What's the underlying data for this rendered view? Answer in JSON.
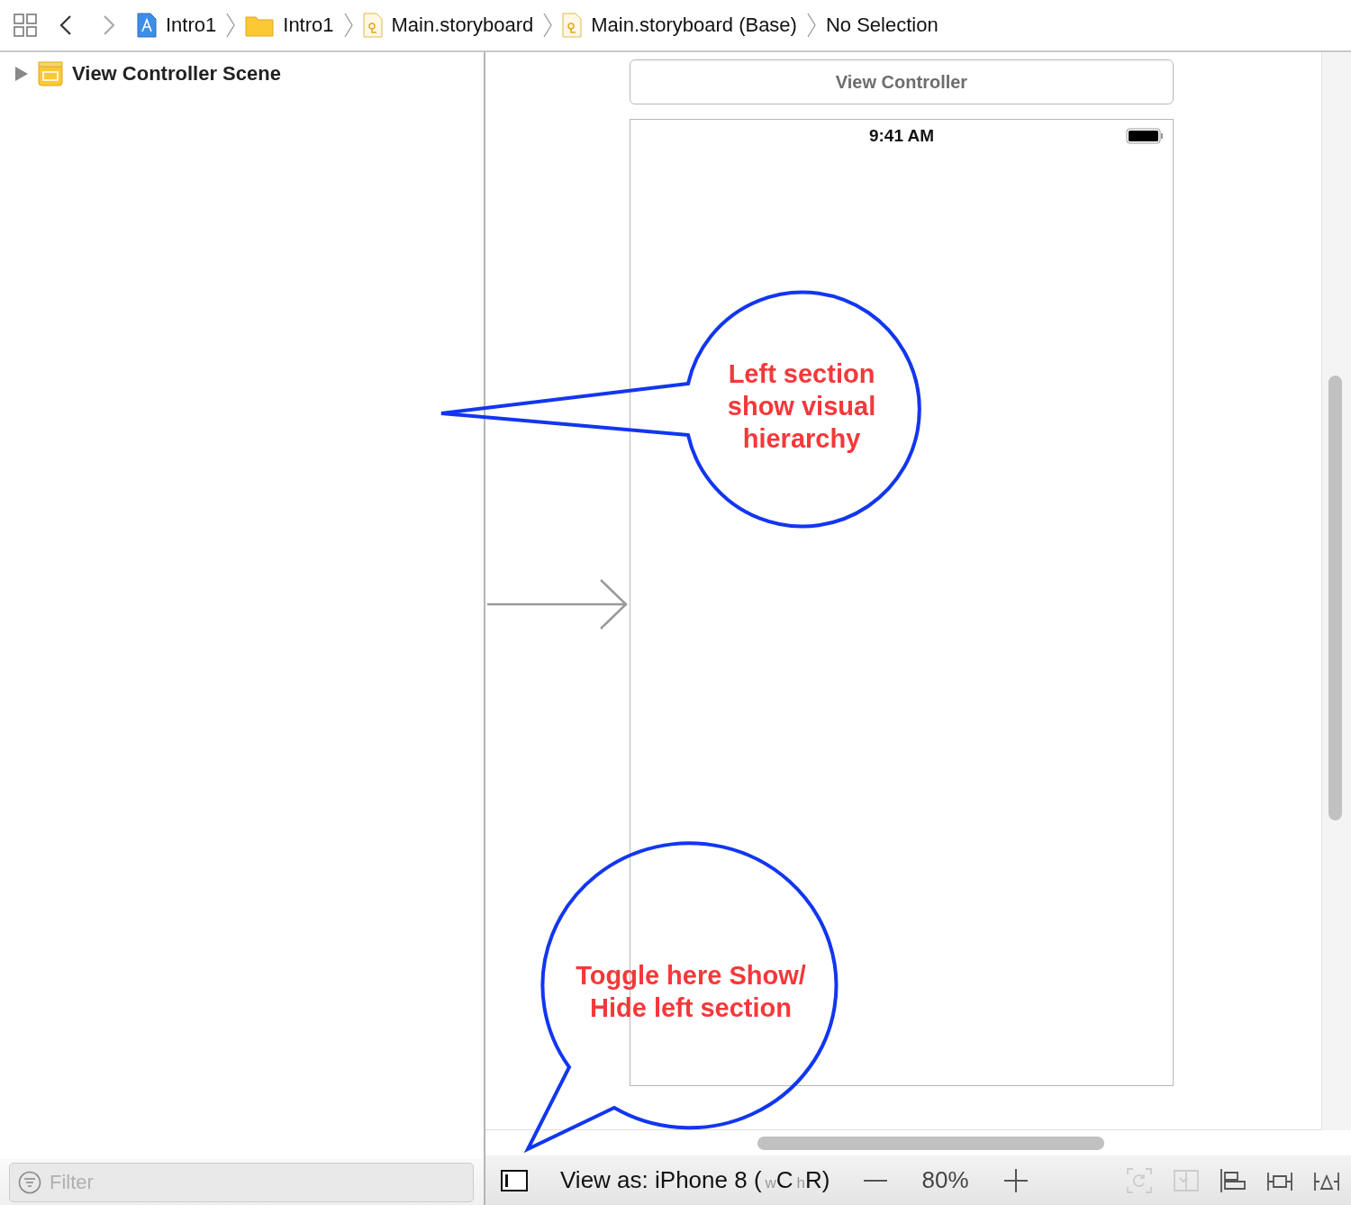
{
  "toolbar": {
    "breadcrumbs": [
      {
        "label": "Intro1",
        "kind": "project"
      },
      {
        "label": "Intro1",
        "kind": "folder"
      },
      {
        "label": "Main.storyboard",
        "kind": "storyboard"
      },
      {
        "label": "Main.storyboard (Base)",
        "kind": "storyboard"
      },
      {
        "label": "No Selection",
        "kind": "none"
      }
    ]
  },
  "outline": {
    "items": [
      {
        "label": "View Controller Scene",
        "expanded": false
      }
    ],
    "filter": {
      "placeholder": "Filter"
    }
  },
  "canvas": {
    "scene_title": "View Controller",
    "status_time": "9:41 AM"
  },
  "bottom_bar": {
    "view_as": [
      {
        "text": "View as: iPhone 8 (",
        "kind": "plain"
      },
      {
        "text": "w",
        "kind": "hint"
      },
      {
        "text": "C",
        "kind": "plain"
      },
      {
        "text": "h",
        "kind": "hint"
      },
      {
        "text": "R)",
        "kind": "plain"
      }
    ],
    "zoom": "80%"
  },
  "callouts": [
    {
      "text": "Left section\nshow visual\nhierarchy",
      "kind": "left"
    },
    {
      "text": "Toggle here Show/\nHide left section",
      "kind": "down"
    }
  ]
}
